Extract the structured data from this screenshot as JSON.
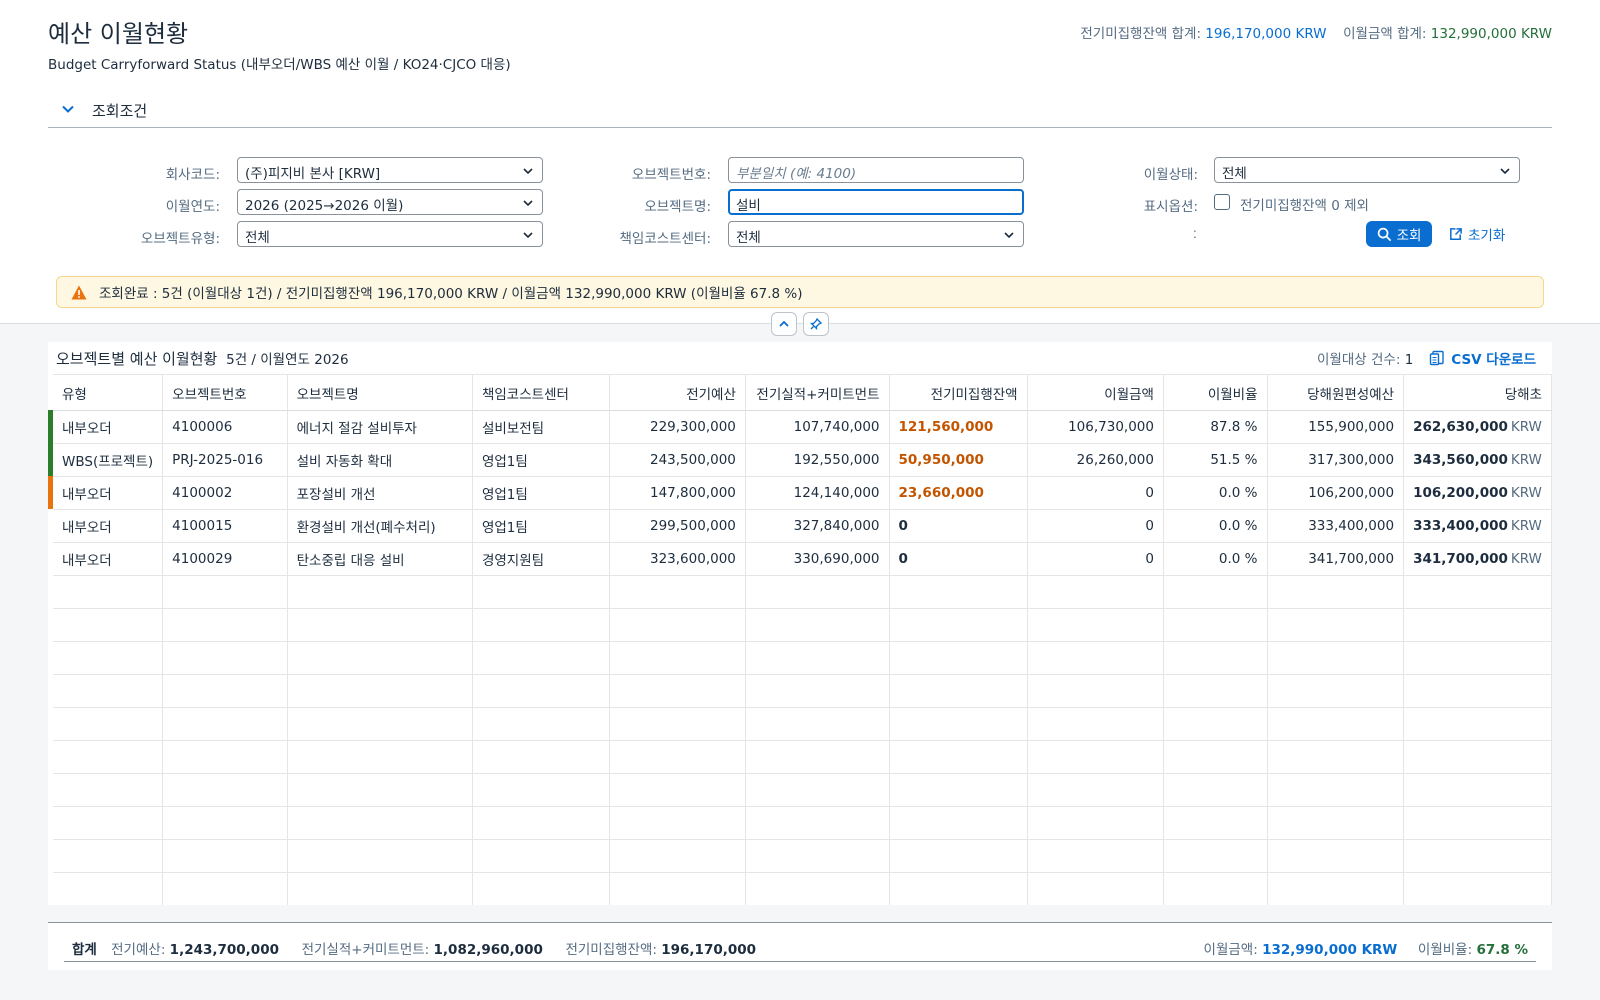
{
  "page": {
    "title": "예산 이월현황",
    "subtitle": "Budget Carryforward Status (내부오더/WBS 예산 이월 / KO24·CJCO 대응)"
  },
  "kpis": {
    "unspent_label": "전기미집행잔액 합계:",
    "unspent_value": "196,170,000 KRW",
    "carry_label": "이월금액 합계:",
    "carry_value": "132,990,000 KRW"
  },
  "filter": {
    "title": "조회조건",
    "company_label": "회사코드:",
    "company_value": "(주)피지비 본사 [KRW]",
    "year_label": "이월연도:",
    "year_value": "2026 (2025→2026 이월)",
    "objtype_label": "오브젝트유형:",
    "objtype_value": "전체",
    "objno_label": "오브젝트번호:",
    "objno_placeholder": "부분일치 (예: 4100)",
    "objname_label": "오브젝트명:",
    "objname_value": "설비",
    "cc_label": "책임코스트센터:",
    "cc_value": "전체",
    "status_label": "이월상태:",
    "status_value": "전체",
    "option_label": "표시옵션:",
    "option_checkbox": "전기미집행잔액 0 제외",
    "colon_only": ":",
    "search_button": "조회",
    "reset_button": "초기화"
  },
  "message": "조회완료 : 5건 (이월대상 1건) / 전기미집행잔액 196,170,000 KRW / 이월금액 132,990,000 KRW (이월비율 67.8 %)",
  "table": {
    "title": "오브젝트별 예산 이월현황",
    "count_text": "5건 / 이월연도 2026",
    "target_label": "이월대상 건수:",
    "target_value": "1",
    "csv_button": "CSV 다운로드",
    "headers": [
      "유형",
      "오브젝트번호",
      "오브젝트명",
      "책임코스트센터",
      "전기예산",
      "전기실적+커미트먼트",
      "전기미집행잔액",
      "이월금액",
      "이월비율",
      "당해원편성예산",
      "당해초"
    ],
    "rows": [
      {
        "type": "내부오더",
        "no": "4100006",
        "name": "에너지 절감 설비투자",
        "cc": "설비보전팀",
        "prev_budget": "229,300,000",
        "prev_actual": "107,740,000",
        "unspent": "121,560,000",
        "carry": "106,730,000",
        "ratio": "87.8 %",
        "orig": "155,900,000",
        "cur": "262,630,000",
        "cur_unit": "KRW",
        "indicator": "#2b7d2b"
      },
      {
        "type": "WBS(프로젝트)",
        "no": "PRJ-2025-016",
        "name": "설비 자동화 확대",
        "cc": "영업1팀",
        "prev_budget": "243,500,000",
        "prev_actual": "192,550,000",
        "unspent": "50,950,000",
        "carry": "26,260,000",
        "ratio": "51.5 %",
        "orig": "317,300,000",
        "cur": "343,560,000",
        "cur_unit": "KRW",
        "indicator": "#2b7d2b"
      },
      {
        "type": "내부오더",
        "no": "4100002",
        "name": "포장설비 개선",
        "cc": "영업1팀",
        "prev_budget": "147,800,000",
        "prev_actual": "124,140,000",
        "unspent": "23,660,000",
        "carry": "0",
        "ratio": "0.0 %",
        "orig": "106,200,000",
        "cur": "106,200,000",
        "cur_unit": "KRW",
        "indicator": "#e9730c"
      },
      {
        "type": "내부오더",
        "no": "4100015",
        "name": "환경설비 개선(폐수처리)",
        "cc": "영업1팀",
        "prev_budget": "299,500,000",
        "prev_actual": "327,840,000",
        "unspent": "0",
        "carry": "0",
        "ratio": "0.0 %",
        "orig": "333,400,000",
        "cur": "333,400,000",
        "cur_unit": "KRW",
        "indicator": ""
      },
      {
        "type": "내부오더",
        "no": "4100029",
        "name": "탄소중립 대응 설비",
        "cc": "경영지원팀",
        "prev_budget": "323,600,000",
        "prev_actual": "330,690,000",
        "unspent": "0",
        "carry": "0",
        "ratio": "0.0 %",
        "orig": "341,700,000",
        "cur": "341,700,000",
        "cur_unit": "KRW",
        "indicator": ""
      }
    ]
  },
  "footer": {
    "total_label": "합계",
    "prev_budget_label": "전기예산:",
    "prev_budget_value": "1,243,700,000",
    "actual_label": "전기실적+커미트먼트:",
    "actual_value": "1,082,960,000",
    "unspent_label": "전기미집행잔액:",
    "unspent_value": "196,170,000",
    "carry_label": "이월금액:",
    "carry_value": "132,990,000 KRW",
    "ratio_label": "이월비율:",
    "ratio_value": "67.8 %"
  }
}
